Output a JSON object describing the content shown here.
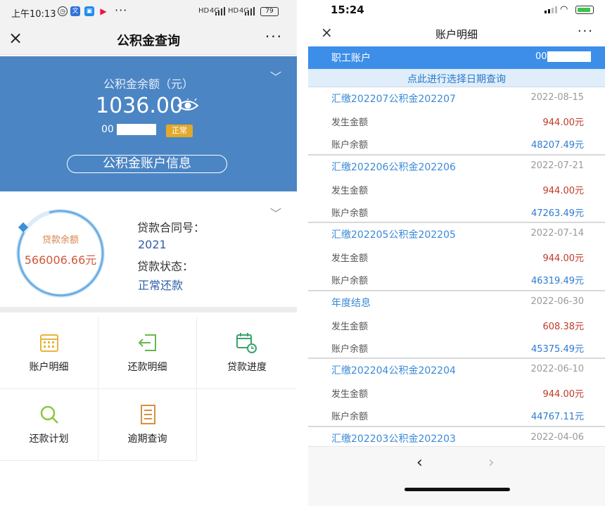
{
  "left": {
    "status": {
      "time": "上午10:13",
      "battery": "79",
      "net1": "HD",
      "net2": "HD",
      "signal1": "4G",
      "signal2": "4G",
      "more": "···"
    },
    "nav": {
      "close": "×",
      "title": "公积金查询",
      "more": "···"
    },
    "balance": {
      "label": "公积金余额（元）",
      "amount": "1036.00",
      "account_prefix": "00",
      "status": "正常",
      "account_info_button": "公积金账户信息",
      "chevron": "﹀"
    },
    "loan": {
      "ring_label": "贷款余额",
      "ring_amount": "566006.66元",
      "contract_label": "贷款合同号：",
      "contract_value": "2021",
      "status_label": "贷款状态：",
      "status_value": "正常还款",
      "chevron": "﹀"
    },
    "grid": [
      {
        "label": "账户明细",
        "icon": "calendar-icon"
      },
      {
        "label": "还款明细",
        "icon": "export-icon"
      },
      {
        "label": "贷款进度",
        "icon": "calendar-clock-icon"
      },
      {
        "label": "还款计划",
        "icon": "search-icon"
      },
      {
        "label": "逾期查询",
        "icon": "document-icon"
      }
    ]
  },
  "right": {
    "status": {
      "time": "15:24",
      "wifi": "◠"
    },
    "nav": {
      "close": "×",
      "title": "账户明细",
      "more": "···"
    },
    "account": {
      "label": "职工账户",
      "value_prefix": "00"
    },
    "date_query": "点此进行选择日期查询",
    "amount_label": "发生金额",
    "balance_label": "账户余额",
    "entries": [
      {
        "title": "汇缴202207公积金202207",
        "date": "2022-08-15",
        "amount": "944.00元",
        "balance": "48207.49元"
      },
      {
        "title": "汇缴202206公积金202206",
        "date": "2022-07-21",
        "amount": "944.00元",
        "balance": "47263.49元"
      },
      {
        "title": "汇缴202205公积金202205",
        "date": "2022-07-14",
        "amount": "944.00元",
        "balance": "46319.49元"
      },
      {
        "title": "年度结息",
        "date": "2022-06-30",
        "amount": "608.38元",
        "balance": "45375.49元"
      },
      {
        "title": "汇缴202204公积金202204",
        "date": "2022-06-10",
        "amount": "944.00元",
        "balance": "44767.11元"
      },
      {
        "title": "汇缴202203公积金202203",
        "date": "2022-04-06",
        "amount": "",
        "balance": ""
      }
    ],
    "bottom": {
      "back": "‹",
      "forward": "›"
    }
  }
}
